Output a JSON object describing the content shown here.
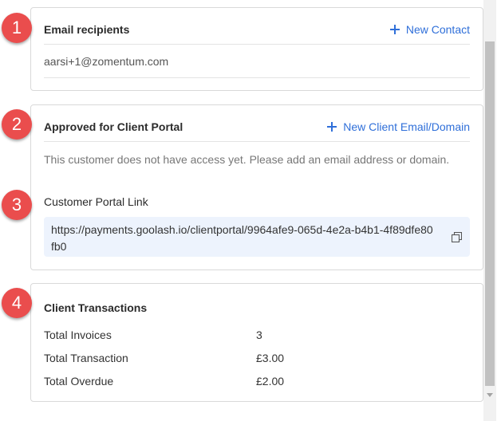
{
  "email_recipients": {
    "title": "Email recipients",
    "action_label": "New Contact",
    "recipients": [
      "aarsi+1@zomentum.com"
    ]
  },
  "client_portal": {
    "title": "Approved for Client Portal",
    "action_label": "New Client Email/Domain",
    "notice": "This customer does not have access yet. Please add an email address or domain.",
    "portal_link_label": "Customer Portal Link",
    "portal_link": "https://payments.goolash.io/clientportal/9964afe9-065d-4e2a-b4b1-4f89dfe80fb0"
  },
  "client_transactions": {
    "title": "Client Transactions",
    "rows": [
      {
        "label": "Total Invoices",
        "value": "3"
      },
      {
        "label": "Total Transaction",
        "value": "£3.00"
      },
      {
        "label": "Total Overdue",
        "value": "£2.00"
      }
    ]
  },
  "badges": [
    "1",
    "2",
    "3",
    "4"
  ],
  "colors": {
    "accent": "#2f6fd9",
    "badge": "#ea4d4d",
    "link_box_bg": "#edf3fd"
  },
  "icons": {
    "add": "plus-icon",
    "copy": "copy-icon"
  }
}
